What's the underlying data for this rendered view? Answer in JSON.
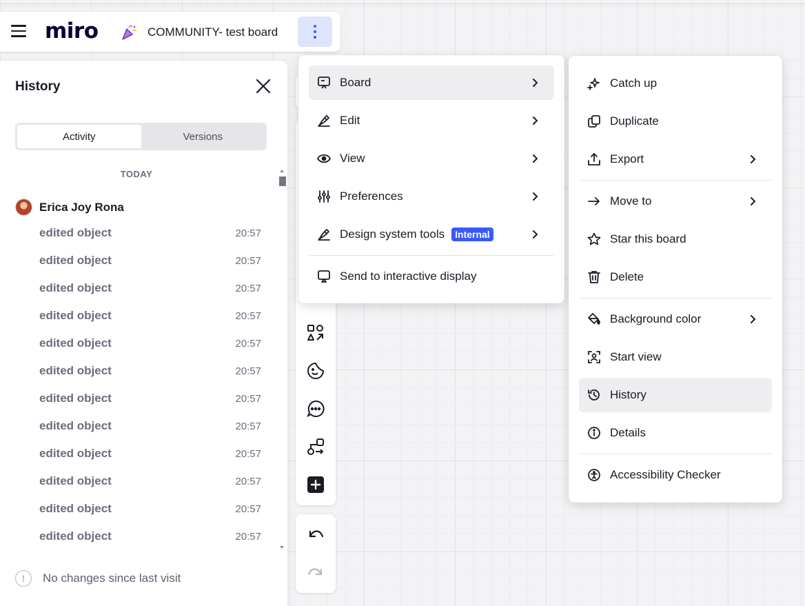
{
  "app": {
    "logo": "miro",
    "board_title": "COMMUNITY- test board"
  },
  "history_panel": {
    "title": "History",
    "tabs": [
      {
        "label": "Activity",
        "active": true
      },
      {
        "label": "Versions",
        "active": false
      }
    ],
    "day_header": "TODAY",
    "user": "Erica Joy Rona",
    "items": [
      {
        "text": "edited object",
        "time": "20:57"
      },
      {
        "text": "edited object",
        "time": "20:57"
      },
      {
        "text": "edited object",
        "time": "20:57"
      },
      {
        "text": "edited object",
        "time": "20:57"
      },
      {
        "text": "edited object",
        "time": "20:57"
      },
      {
        "text": "edited object",
        "time": "20:57"
      },
      {
        "text": "edited object",
        "time": "20:57"
      },
      {
        "text": "edited object",
        "time": "20:57"
      },
      {
        "text": "edited object",
        "time": "20:57"
      },
      {
        "text": "edited object",
        "time": "20:57"
      },
      {
        "text": "edited object",
        "time": "20:57"
      },
      {
        "text": "edited object",
        "time": "20:57"
      }
    ],
    "footer": "No changes since last visit"
  },
  "main_menu": {
    "items": [
      {
        "label": "Board",
        "icon": "board-icon",
        "submenu": true,
        "highlighted": true
      },
      {
        "label": "Edit",
        "icon": "pen-icon",
        "submenu": true
      },
      {
        "label": "View",
        "icon": "eye-icon",
        "submenu": true
      },
      {
        "label": "Preferences",
        "icon": "sliders-icon",
        "submenu": true
      },
      {
        "label": "Design system tools",
        "icon": "pen-icon",
        "submenu": true,
        "badge": "Internal"
      },
      {
        "label": "Send to interactive display",
        "icon": "display-icon",
        "submenu": false
      }
    ]
  },
  "board_submenu": {
    "items": [
      {
        "label": "Catch up",
        "icon": "sparkle-icon"
      },
      {
        "label": "Duplicate",
        "icon": "duplicate-icon"
      },
      {
        "label": "Export",
        "icon": "export-icon",
        "submenu": true
      },
      {
        "label": "Move to",
        "icon": "arrow-right-icon",
        "submenu": true
      },
      {
        "label": "Star this board",
        "icon": "star-icon"
      },
      {
        "label": "Delete",
        "icon": "trash-icon"
      },
      {
        "label": "Background color",
        "icon": "paint-bucket-icon",
        "submenu": true
      },
      {
        "label": "Start view",
        "icon": "start-view-icon"
      },
      {
        "label": "History",
        "icon": "history-icon",
        "highlighted": true
      },
      {
        "label": "Details",
        "icon": "info-icon"
      },
      {
        "label": "Accessibility Checker",
        "icon": "accessibility-icon"
      }
    ]
  },
  "toolbar": {
    "tools": [
      "shapes-icon",
      "sticker-icon",
      "comment-icon",
      "flow-icon",
      "plus-square-icon"
    ],
    "undo": "undo-icon",
    "redo": "redo-icon"
  },
  "colors": {
    "accent": "#3859ff",
    "accent_bg": "#dde4fb",
    "highlight": "#eeeef1",
    "muted_text": "#6c6d7d"
  }
}
